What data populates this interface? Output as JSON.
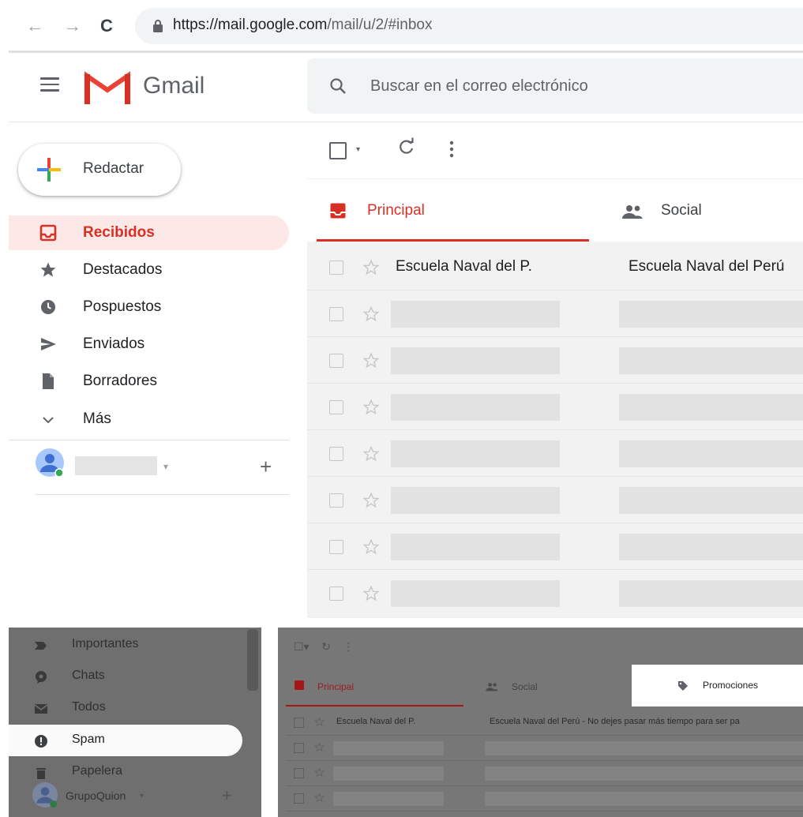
{
  "browser": {
    "url_host": "https://mail.google.com",
    "url_path": "/mail/u/2/#inbox"
  },
  "header": {
    "app_name": "Gmail",
    "search_placeholder": "Buscar en el correo electrónico"
  },
  "compose": {
    "label": "Redactar"
  },
  "sidebar": {
    "items": [
      {
        "label": "Recibidos",
        "icon": "inbox-icon",
        "active": true
      },
      {
        "label": "Destacados",
        "icon": "star-icon"
      },
      {
        "label": "Pospuestos",
        "icon": "clock-icon"
      },
      {
        "label": "Enviados",
        "icon": "send-icon"
      },
      {
        "label": "Borradores",
        "icon": "draft-icon"
      },
      {
        "label": "Más",
        "icon": "chevron-down-icon"
      }
    ]
  },
  "tabs": {
    "principal": "Principal",
    "social": "Social"
  },
  "email_rows": [
    {
      "sender": "Escuela Naval del P.",
      "subject": "Escuela Naval del Perú"
    }
  ],
  "bottom_sidebar": {
    "items": [
      {
        "label": "Importantes",
        "icon": "important-icon"
      },
      {
        "label": "Chats",
        "icon": "chat-icon"
      },
      {
        "label": "Todos",
        "icon": "mail-icon"
      },
      {
        "label": "Spam",
        "icon": "spam-icon",
        "active": true
      },
      {
        "label": "Papelera",
        "icon": "trash-icon"
      }
    ],
    "account_name": "GrupoQuion"
  },
  "bottom_main": {
    "tabs": {
      "principal": "Principal",
      "social": "Social",
      "promociones": "Promociones"
    },
    "row": {
      "sender": "Escuela Naval del P.",
      "subject": "Escuela Naval del Perú - No dejes pasar más tiempo para ser pa"
    }
  },
  "colors": {
    "accent_red": "#d93025",
    "active_bg": "#fce8e6"
  }
}
